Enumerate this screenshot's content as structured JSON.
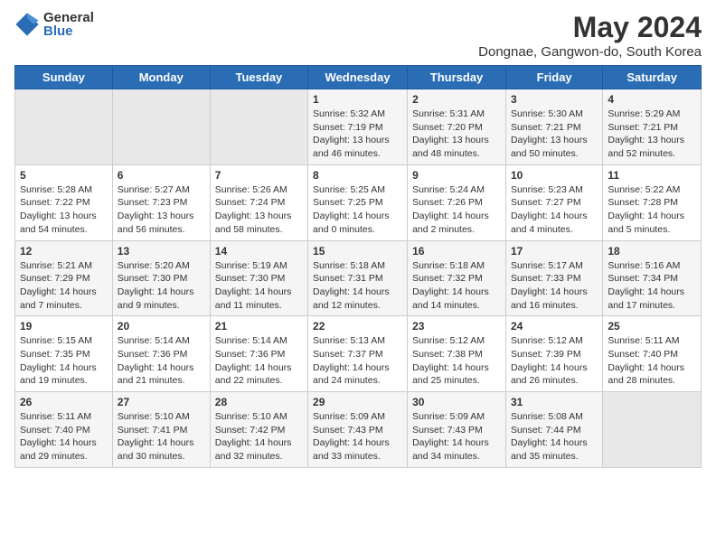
{
  "header": {
    "logo_general": "General",
    "logo_blue": "Blue",
    "title": "May 2024",
    "subtitle": "Dongnae, Gangwon-do, South Korea"
  },
  "weekdays": [
    "Sunday",
    "Monday",
    "Tuesday",
    "Wednesday",
    "Thursday",
    "Friday",
    "Saturday"
  ],
  "rows": [
    [
      {
        "day": "",
        "info": ""
      },
      {
        "day": "",
        "info": ""
      },
      {
        "day": "",
        "info": ""
      },
      {
        "day": "1",
        "info": "Sunrise: 5:32 AM\nSunset: 7:19 PM\nDaylight: 13 hours\nand 46 minutes."
      },
      {
        "day": "2",
        "info": "Sunrise: 5:31 AM\nSunset: 7:20 PM\nDaylight: 13 hours\nand 48 minutes."
      },
      {
        "day": "3",
        "info": "Sunrise: 5:30 AM\nSunset: 7:21 PM\nDaylight: 13 hours\nand 50 minutes."
      },
      {
        "day": "4",
        "info": "Sunrise: 5:29 AM\nSunset: 7:21 PM\nDaylight: 13 hours\nand 52 minutes."
      }
    ],
    [
      {
        "day": "5",
        "info": "Sunrise: 5:28 AM\nSunset: 7:22 PM\nDaylight: 13 hours\nand 54 minutes."
      },
      {
        "day": "6",
        "info": "Sunrise: 5:27 AM\nSunset: 7:23 PM\nDaylight: 13 hours\nand 56 minutes."
      },
      {
        "day": "7",
        "info": "Sunrise: 5:26 AM\nSunset: 7:24 PM\nDaylight: 13 hours\nand 58 minutes."
      },
      {
        "day": "8",
        "info": "Sunrise: 5:25 AM\nSunset: 7:25 PM\nDaylight: 14 hours\nand 0 minutes."
      },
      {
        "day": "9",
        "info": "Sunrise: 5:24 AM\nSunset: 7:26 PM\nDaylight: 14 hours\nand 2 minutes."
      },
      {
        "day": "10",
        "info": "Sunrise: 5:23 AM\nSunset: 7:27 PM\nDaylight: 14 hours\nand 4 minutes."
      },
      {
        "day": "11",
        "info": "Sunrise: 5:22 AM\nSunset: 7:28 PM\nDaylight: 14 hours\nand 5 minutes."
      }
    ],
    [
      {
        "day": "12",
        "info": "Sunrise: 5:21 AM\nSunset: 7:29 PM\nDaylight: 14 hours\nand 7 minutes."
      },
      {
        "day": "13",
        "info": "Sunrise: 5:20 AM\nSunset: 7:30 PM\nDaylight: 14 hours\nand 9 minutes."
      },
      {
        "day": "14",
        "info": "Sunrise: 5:19 AM\nSunset: 7:30 PM\nDaylight: 14 hours\nand 11 minutes."
      },
      {
        "day": "15",
        "info": "Sunrise: 5:18 AM\nSunset: 7:31 PM\nDaylight: 14 hours\nand 12 minutes."
      },
      {
        "day": "16",
        "info": "Sunrise: 5:18 AM\nSunset: 7:32 PM\nDaylight: 14 hours\nand 14 minutes."
      },
      {
        "day": "17",
        "info": "Sunrise: 5:17 AM\nSunset: 7:33 PM\nDaylight: 14 hours\nand 16 minutes."
      },
      {
        "day": "18",
        "info": "Sunrise: 5:16 AM\nSunset: 7:34 PM\nDaylight: 14 hours\nand 17 minutes."
      }
    ],
    [
      {
        "day": "19",
        "info": "Sunrise: 5:15 AM\nSunset: 7:35 PM\nDaylight: 14 hours\nand 19 minutes."
      },
      {
        "day": "20",
        "info": "Sunrise: 5:14 AM\nSunset: 7:36 PM\nDaylight: 14 hours\nand 21 minutes."
      },
      {
        "day": "21",
        "info": "Sunrise: 5:14 AM\nSunset: 7:36 PM\nDaylight: 14 hours\nand 22 minutes."
      },
      {
        "day": "22",
        "info": "Sunrise: 5:13 AM\nSunset: 7:37 PM\nDaylight: 14 hours\nand 24 minutes."
      },
      {
        "day": "23",
        "info": "Sunrise: 5:12 AM\nSunset: 7:38 PM\nDaylight: 14 hours\nand 25 minutes."
      },
      {
        "day": "24",
        "info": "Sunrise: 5:12 AM\nSunset: 7:39 PM\nDaylight: 14 hours\nand 26 minutes."
      },
      {
        "day": "25",
        "info": "Sunrise: 5:11 AM\nSunset: 7:40 PM\nDaylight: 14 hours\nand 28 minutes."
      }
    ],
    [
      {
        "day": "26",
        "info": "Sunrise: 5:11 AM\nSunset: 7:40 PM\nDaylight: 14 hours\nand 29 minutes."
      },
      {
        "day": "27",
        "info": "Sunrise: 5:10 AM\nSunset: 7:41 PM\nDaylight: 14 hours\nand 30 minutes."
      },
      {
        "day": "28",
        "info": "Sunrise: 5:10 AM\nSunset: 7:42 PM\nDaylight: 14 hours\nand 32 minutes."
      },
      {
        "day": "29",
        "info": "Sunrise: 5:09 AM\nSunset: 7:43 PM\nDaylight: 14 hours\nand 33 minutes."
      },
      {
        "day": "30",
        "info": "Sunrise: 5:09 AM\nSunset: 7:43 PM\nDaylight: 14 hours\nand 34 minutes."
      },
      {
        "day": "31",
        "info": "Sunrise: 5:08 AM\nSunset: 7:44 PM\nDaylight: 14 hours\nand 35 minutes."
      },
      {
        "day": "",
        "info": ""
      }
    ]
  ]
}
